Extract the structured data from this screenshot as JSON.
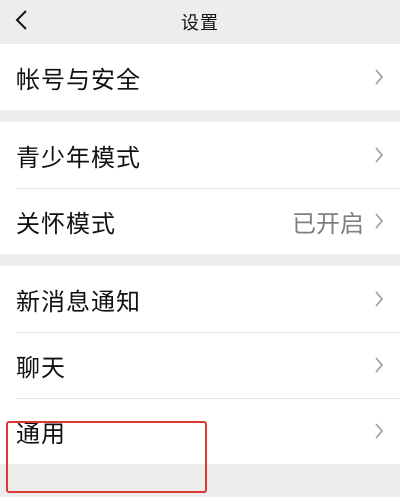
{
  "header": {
    "title": "设置",
    "back_icon": "chevron-left-icon"
  },
  "groups": [
    {
      "items": [
        {
          "label": "帐号与安全",
          "value": ""
        }
      ]
    },
    {
      "items": [
        {
          "label": "青少年模式",
          "value": ""
        },
        {
          "label": "关怀模式",
          "value": "已开启"
        }
      ]
    },
    {
      "items": [
        {
          "label": "新消息通知",
          "value": ""
        },
        {
          "label": "聊天",
          "value": ""
        },
        {
          "label": "通用",
          "value": ""
        }
      ]
    }
  ],
  "colors": {
    "background": "#ededed",
    "row_background": "#ffffff",
    "highlight_border": "#d9392e",
    "value_text": "#7f7f7f"
  }
}
